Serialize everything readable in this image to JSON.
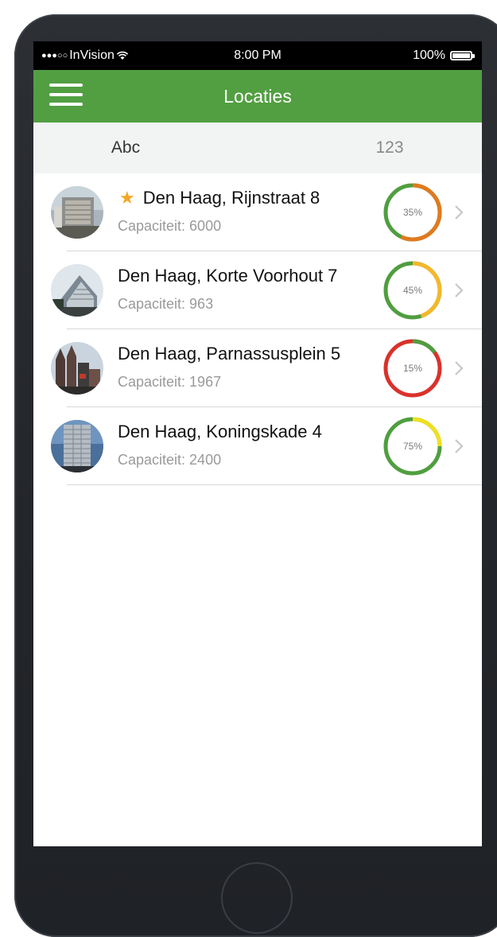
{
  "status_bar": {
    "carrier": "InVision",
    "time": "8:00 PM",
    "battery": "100%",
    "icons": [
      "signal-dots-icon",
      "wifi-icon",
      "battery-icon"
    ]
  },
  "navbar": {
    "title": "Locaties",
    "menu_icon": "hamburger-menu-icon",
    "color": "#529f42"
  },
  "segmented_control": {
    "tabs": [
      {
        "label": "Abc",
        "selected": true
      },
      {
        "label": "123",
        "selected": false
      }
    ]
  },
  "locations": [
    {
      "title": "Den Haag, Rijnstraat 8",
      "favorite": true,
      "capacity": "Capaciteit: 6000",
      "occupancy_label": "35%",
      "occupancy": 0.35
    },
    {
      "title": "Den Haag, Korte Voorhout 7",
      "favorite": false,
      "capacity": "Capaciteit: 963",
      "occupancy_label": "45%",
      "occupancy": 0.45
    },
    {
      "title": "Den Haag, Parnassusplein 5",
      "favorite": false,
      "capacity": "Capaciteit: 1967",
      "occupancy_label": "15%",
      "occupancy": 0.15
    },
    {
      "title": "Den Haag, Koningskade 4",
      "favorite": false,
      "capacity": "Capaciteit: 2400",
      "occupancy_label": "75%",
      "occupancy": 0.75
    }
  ],
  "colors": {
    "gauge_green": "#4f9e3f",
    "gauge_orange": "#e07a1f",
    "gauge_amber": "#f4b82a",
    "gauge_red": "#d9322b",
    "gauge_yellow": "#f0e020",
    "star": "#f6a623"
  }
}
